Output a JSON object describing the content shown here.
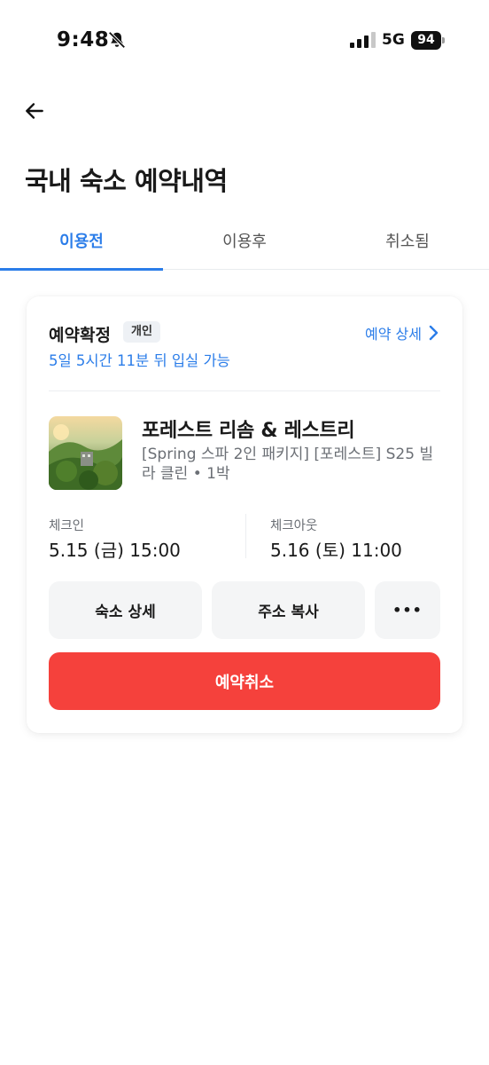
{
  "status_bar": {
    "time": "9:48",
    "network": "5G",
    "battery": "94",
    "icons": [
      "bell-slash-icon",
      "signal-icon",
      "battery-icon"
    ]
  },
  "header": {
    "back_icon": "arrow-left-icon",
    "title": "국내 숙소 예약내역"
  },
  "tabs": [
    {
      "label": "이용전",
      "active": true
    },
    {
      "label": "이용후",
      "active": false
    },
    {
      "label": "취소됨",
      "active": false
    }
  ],
  "booking": {
    "status": "예약확정",
    "badge": "개인",
    "detail_link": "예약 상세",
    "countdown": "5일 5시간 11분 뒤 입실 가능",
    "hotel_name": "포레스트 리솜 & 레스트리",
    "package": "[Spring 스파 2인 패키지] [포레스트] S25 빌라 클린 • 1박",
    "checkin_label": "체크인",
    "checkin_value": "5.15 (금) 15:00",
    "checkout_label": "체크아웃",
    "checkout_value": "5.16 (토) 11:00",
    "buttons": {
      "lodging_detail": "숙소 상세",
      "copy_address": "주소 복사",
      "more": "•••",
      "cancel": "예약취소"
    }
  },
  "colors": {
    "accent": "#2b7de9",
    "danger": "#f5413c",
    "muted": "#6b6f75"
  }
}
